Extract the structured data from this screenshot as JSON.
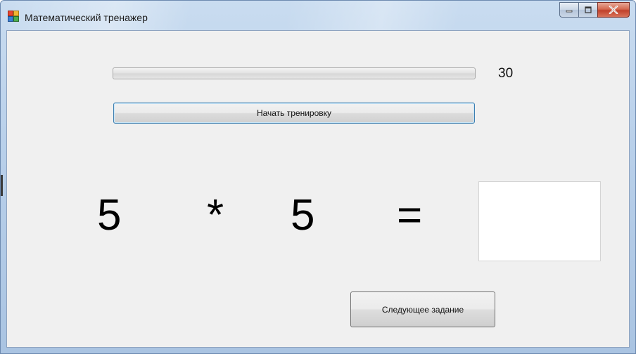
{
  "window": {
    "title": "Математический тренажер",
    "icon": "winforms-app-icon",
    "caption_icons": [
      "minimize-icon",
      "maximize-icon",
      "close-icon"
    ]
  },
  "timer": {
    "value": "30",
    "progress_fraction": 0.0
  },
  "buttons": {
    "start_label": "Начать тренировку",
    "next_label": "Следующее задание"
  },
  "task": {
    "operand_a": "5",
    "operator": "*",
    "operand_b": "5",
    "equals": "=",
    "answer_value": ""
  },
  "colors": {
    "client_background": "#f0f0f0",
    "focus_border": "#3c7fb1",
    "close_button": "#c0402a"
  }
}
